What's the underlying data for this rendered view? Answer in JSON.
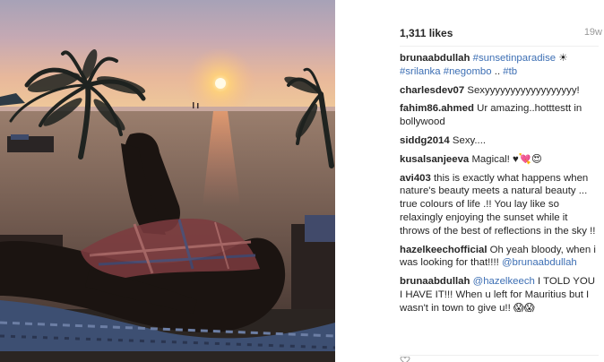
{
  "post": {
    "likes": "1,311 likes",
    "time_ago": "19w"
  },
  "comments": [
    {
      "user": "brunaabdullah",
      "parts": [
        {
          "t": "link",
          "v": "#sunsetinparadise"
        },
        {
          "t": "text",
          "v": " ☀ "
        },
        {
          "t": "link",
          "v": "#srilanka"
        },
        {
          "t": "text",
          "v": " "
        },
        {
          "t": "link",
          "v": "#negombo"
        },
        {
          "t": "text",
          "v": " .. "
        },
        {
          "t": "link",
          "v": "#tb"
        }
      ]
    },
    {
      "user": "charlesdev07",
      "parts": [
        {
          "t": "text",
          "v": "Sexyyyyyyyyyyyyyyyyyy!"
        }
      ]
    },
    {
      "user": "fahim86.ahmed",
      "parts": [
        {
          "t": "text",
          "v": "Ur amazing..hotttestt in bollywood"
        }
      ]
    },
    {
      "user": "siddg2014",
      "parts": [
        {
          "t": "text",
          "v": "Sexy...."
        }
      ]
    },
    {
      "user": "kusalsanjeeva",
      "parts": [
        {
          "t": "text",
          "v": "Magical! ♥💘😍"
        }
      ]
    },
    {
      "user": "avi403",
      "parts": [
        {
          "t": "text",
          "v": "this is exactly what happens when nature's beauty meets a natural beauty ... true colours of life .!! You lay like so relaxingly enjoying the sunset while it throws of the best of reflections in the sky !!"
        }
      ]
    },
    {
      "user": "hazelkeechofficial",
      "parts": [
        {
          "t": "text",
          "v": "Oh yeah bloody, when i was looking for that!!!! "
        },
        {
          "t": "link",
          "v": "@brunaabdullah"
        }
      ]
    },
    {
      "user": "brunaabdullah",
      "parts": [
        {
          "t": "link",
          "v": "@hazelkeech"
        },
        {
          "t": "text",
          "v": " I TOLD YOU I HAVE IT!!! When u left for Mauritius but I wasn't in town to give u!! 😱😱"
        }
      ]
    }
  ],
  "icons": {
    "sun": "sun-icon",
    "like": "heart-icon"
  },
  "colors": {
    "link": "#3d6fb4",
    "username": "#262626",
    "timestamp": "#999999"
  }
}
